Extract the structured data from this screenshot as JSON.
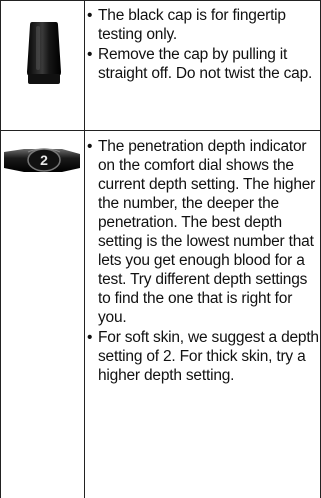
{
  "rows": [
    {
      "image": "lancing-device-black-cap",
      "bullets": [
        "The black cap is for fingertip testing only.",
        "Remove the cap by pulling it straight off. Do not twist the cap."
      ]
    },
    {
      "image": "comfort-dial-depth-indicator",
      "bullets": [
        "The penetration depth indicator on the comfort dial shows the current depth setting. The higher the number, the deeper the penetration. The best depth setting is the lowest number that lets you get enough blood for a test. Try different depth settings to find the one that is right for you.",
        "For soft skin, we suggest a depth setting of 2. For thick skin, try a higher depth setting."
      ]
    }
  ],
  "dial_number": "2",
  "bullet_glyph": "•"
}
